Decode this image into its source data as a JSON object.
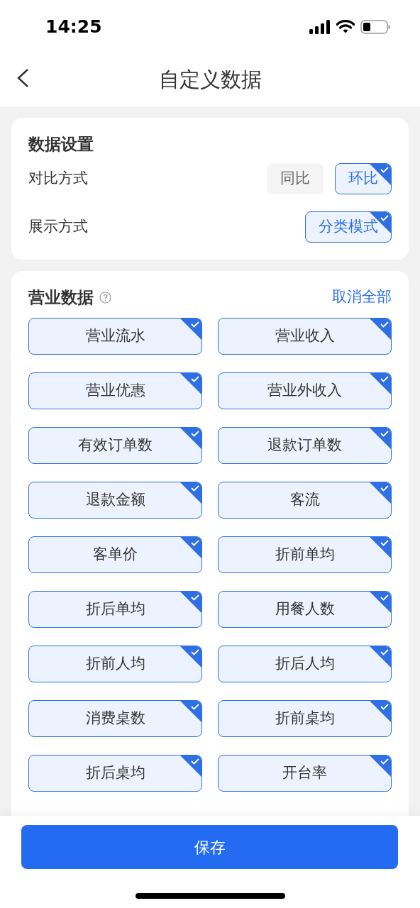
{
  "status_bar": {
    "time": "14:25"
  },
  "header": {
    "title": "自定义数据"
  },
  "settings": {
    "title": "数据设置",
    "rows": [
      {
        "label": "对比方式",
        "options": [
          {
            "label": "同比",
            "selected": false
          },
          {
            "label": "环比",
            "selected": true
          }
        ]
      },
      {
        "label": "展示方式",
        "options": [
          {
            "label": "分类模式",
            "selected": true
          }
        ]
      }
    ]
  },
  "section": {
    "title": "营业数据",
    "action": "取消全部",
    "items": [
      {
        "label": "营业流水",
        "selected": true
      },
      {
        "label": "营业收入",
        "selected": true
      },
      {
        "label": "营业优惠",
        "selected": true
      },
      {
        "label": "营业外收入",
        "selected": true
      },
      {
        "label": "有效订单数",
        "selected": true
      },
      {
        "label": "退款订单数",
        "selected": true
      },
      {
        "label": "退款金额",
        "selected": true
      },
      {
        "label": "客流",
        "selected": true
      },
      {
        "label": "客单价",
        "selected": true
      },
      {
        "label": "折前单均",
        "selected": true
      },
      {
        "label": "折后单均",
        "selected": true
      },
      {
        "label": "用餐人数",
        "selected": true
      },
      {
        "label": "折前人均",
        "selected": true
      },
      {
        "label": "折后人均",
        "selected": true
      },
      {
        "label": "消费桌数",
        "selected": true
      },
      {
        "label": "折前桌均",
        "selected": true
      },
      {
        "label": "折后桌均",
        "selected": true
      },
      {
        "label": "开台率",
        "selected": true
      }
    ]
  },
  "save_button": "保存"
}
